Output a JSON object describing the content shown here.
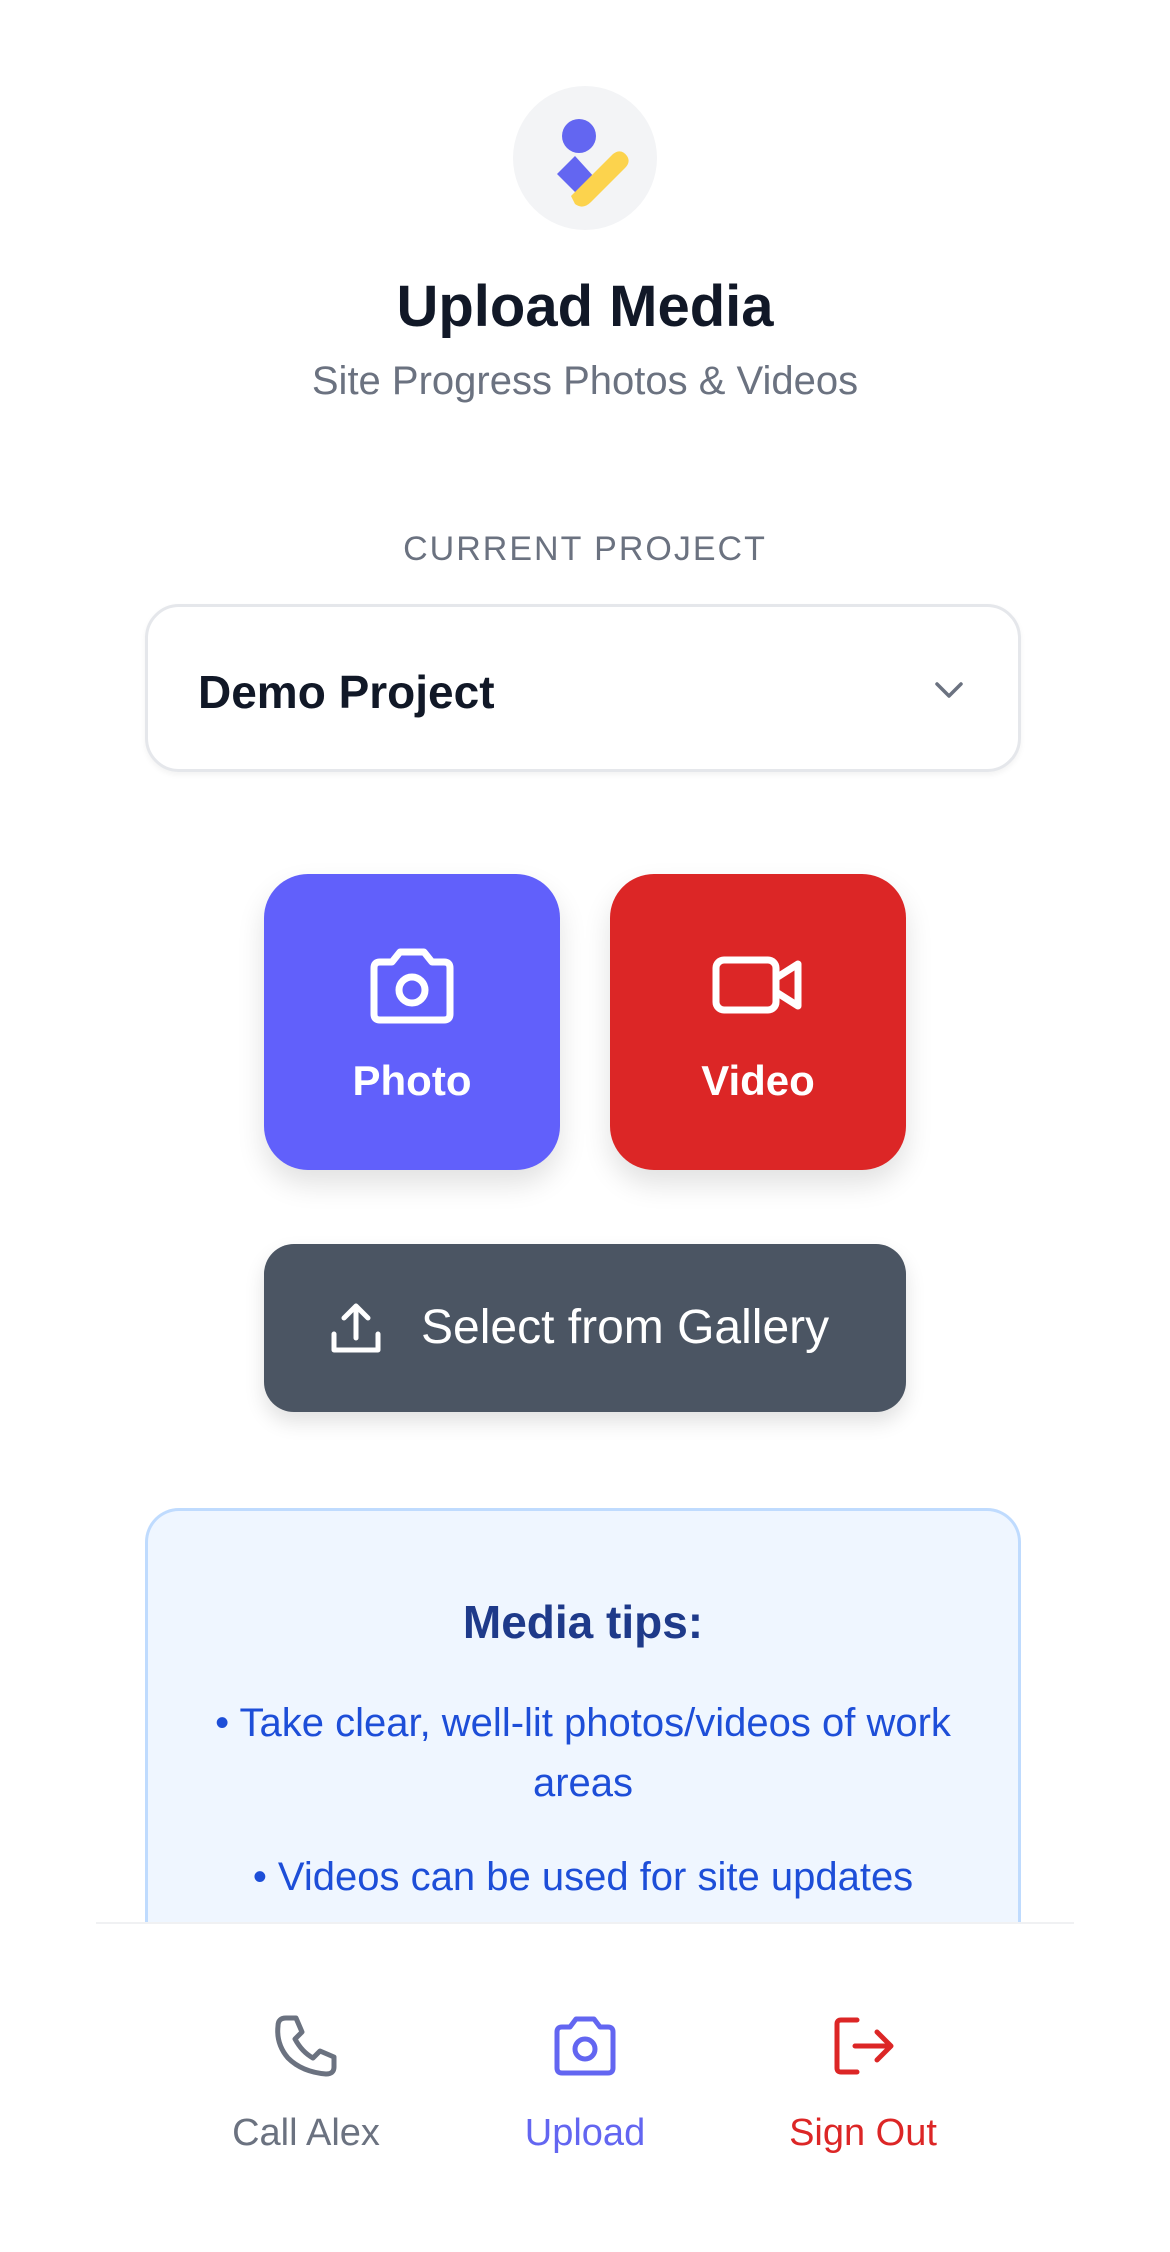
{
  "header": {
    "logo_icon": "person-check-logo-icon",
    "title": "Upload Media",
    "subtitle": "Site Progress Photos & Videos"
  },
  "project": {
    "section_label": "CURRENT PROJECT",
    "selected": "Demo Project",
    "chevron_icon": "chevron-down-icon"
  },
  "actions": {
    "photo": {
      "label": "Photo",
      "icon": "camera-icon",
      "color": "#6160fb"
    },
    "video": {
      "label": "Video",
      "icon": "video-camera-icon",
      "color": "#dc2626"
    },
    "gallery": {
      "label": "Select from Gallery",
      "icon": "upload-icon",
      "color": "#4b5563"
    }
  },
  "tips": {
    "title": "Media tips:",
    "items": [
      "• Take clear, well-lit photos/videos of work areas",
      "• Videos can be used for site updates"
    ]
  },
  "nav": {
    "items": [
      {
        "label": "Call Alex",
        "icon": "phone-icon",
        "color": "#6b7280"
      },
      {
        "label": "Upload",
        "icon": "camera-icon",
        "color": "#6366f1",
        "active": true
      },
      {
        "label": "Sign Out",
        "icon": "sign-out-icon",
        "color": "#dc2626"
      }
    ]
  }
}
